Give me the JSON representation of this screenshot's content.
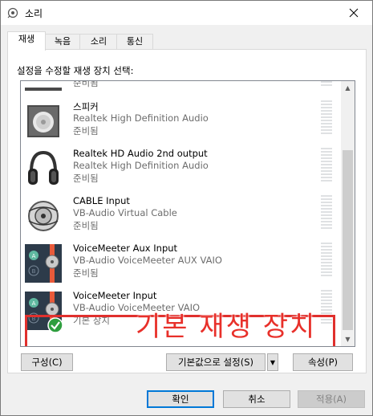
{
  "window": {
    "title": "소리"
  },
  "tabs": [
    {
      "label": "재생",
      "active": true
    },
    {
      "label": "녹음",
      "active": false
    },
    {
      "label": "소리",
      "active": false
    },
    {
      "label": "통신",
      "active": false
    }
  ],
  "panel": {
    "prompt": "설정을 수정할 재생 장치 선택:"
  },
  "devices": [
    {
      "name": "",
      "driver": "",
      "status": "준비됨",
      "icon": "monitor-icon"
    },
    {
      "name": "스피커",
      "driver": "Realtek High Definition Audio",
      "status": "준비됨",
      "icon": "speaker-icon"
    },
    {
      "name": "Realtek HD Audio 2nd output",
      "driver": "Realtek High Definition Audio",
      "status": "준비됨",
      "icon": "headphones-icon"
    },
    {
      "name": "CABLE Input",
      "driver": "VB-Audio Virtual Cable",
      "status": "준비됨",
      "icon": "cable-icon"
    },
    {
      "name": "VoiceMeeter Aux Input",
      "driver": "VB-Audio VoiceMeeter AUX VAIO",
      "status": "준비됨",
      "icon": "voicemeeter-icon"
    },
    {
      "name": "VoiceMeeter Input",
      "driver": "VB-Audio VoiceMeeter VAIO",
      "status": "기본 장치",
      "icon": "voicemeeter-icon",
      "default": true
    }
  ],
  "annotation": {
    "text": "기본 재생 장치"
  },
  "buttons": {
    "configure": "구성(C)",
    "set_default": "기본값으로 설정(S)",
    "properties": "속성(P)",
    "ok": "확인",
    "cancel": "취소",
    "apply": "적용(A)"
  },
  "colors": {
    "annotation": "#e0302d",
    "default_check": "#2e9e3e",
    "selection": "#cce8ff"
  }
}
